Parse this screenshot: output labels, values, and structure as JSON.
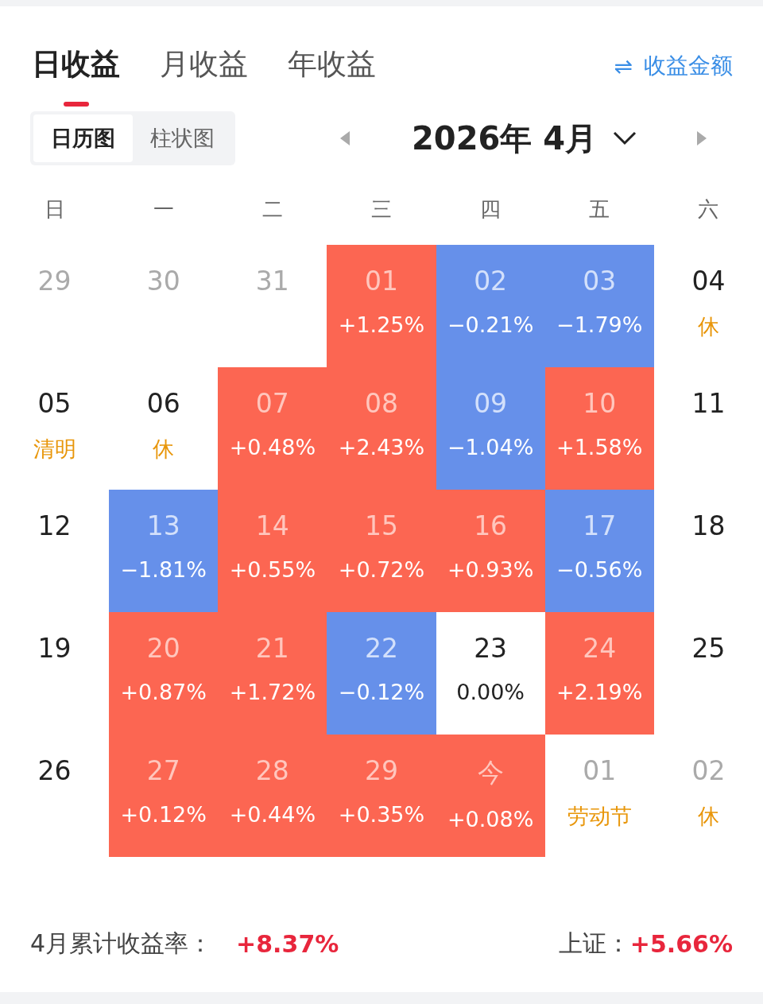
{
  "tabs": [
    {
      "label": "日收益",
      "selected": true
    },
    {
      "label": "月收益",
      "selected": false
    },
    {
      "label": "年收益",
      "selected": false
    }
  ],
  "toggle_link": {
    "icon": "⇌",
    "label": "收益金额"
  },
  "view_switch": [
    {
      "label": "日历图",
      "selected": true
    },
    {
      "label": "柱状图",
      "selected": false
    }
  ],
  "month_nav": {
    "title": "2026年 4月"
  },
  "weekdays": [
    "日",
    "一",
    "二",
    "三",
    "四",
    "五",
    "六"
  ],
  "days": [
    {
      "day": "29",
      "kind": "other"
    },
    {
      "day": "30",
      "kind": "other"
    },
    {
      "day": "31",
      "kind": "other"
    },
    {
      "day": "01",
      "kind": "up",
      "note": "+1.25%"
    },
    {
      "day": "02",
      "kind": "down",
      "note": "−0.21%"
    },
    {
      "day": "03",
      "kind": "down",
      "note": "−1.79%"
    },
    {
      "day": "04",
      "kind": "plain",
      "note": "休"
    },
    {
      "day": "05",
      "kind": "plain",
      "note": "清明"
    },
    {
      "day": "06",
      "kind": "plain",
      "note": "休"
    },
    {
      "day": "07",
      "kind": "up",
      "note": "+0.48%"
    },
    {
      "day": "08",
      "kind": "up",
      "note": "+2.43%"
    },
    {
      "day": "09",
      "kind": "down",
      "note": "−1.04%"
    },
    {
      "day": "10",
      "kind": "up",
      "note": "+1.58%"
    },
    {
      "day": "11",
      "kind": "plain"
    },
    {
      "day": "12",
      "kind": "plain"
    },
    {
      "day": "13",
      "kind": "down",
      "note": "−1.81%"
    },
    {
      "day": "14",
      "kind": "up",
      "note": "+0.55%"
    },
    {
      "day": "15",
      "kind": "up",
      "note": "+0.72%"
    },
    {
      "day": "16",
      "kind": "up",
      "note": "+0.93%"
    },
    {
      "day": "17",
      "kind": "down",
      "note": "−0.56%"
    },
    {
      "day": "18",
      "kind": "plain"
    },
    {
      "day": "19",
      "kind": "plain"
    },
    {
      "day": "20",
      "kind": "up",
      "note": "+0.87%"
    },
    {
      "day": "21",
      "kind": "up",
      "note": "+1.72%"
    },
    {
      "day": "22",
      "kind": "down",
      "note": "−0.12%"
    },
    {
      "day": "23",
      "kind": "flat",
      "note": "0.00%"
    },
    {
      "day": "24",
      "kind": "up",
      "note": "+2.19%"
    },
    {
      "day": "25",
      "kind": "plain"
    },
    {
      "day": "26",
      "kind": "plain"
    },
    {
      "day": "27",
      "kind": "up",
      "note": "+0.12%"
    },
    {
      "day": "28",
      "kind": "up",
      "note": "+0.44%"
    },
    {
      "day": "29",
      "kind": "up",
      "note": "+0.35%"
    },
    {
      "day": "今",
      "kind": "up",
      "note": "+0.08%"
    },
    {
      "day": "01",
      "kind": "other",
      "note": "劳动节"
    },
    {
      "day": "02",
      "kind": "other",
      "note": "休"
    }
  ],
  "summary": {
    "label": "4月累计收益率：",
    "value": "+8.37%",
    "index_label": "上证：",
    "index_value": "+5.66%"
  }
}
